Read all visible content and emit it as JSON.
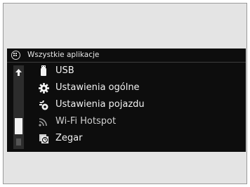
{
  "header": {
    "title": "Wszystkie aplikacje",
    "icon": "apps-grid-icon"
  },
  "scroll": {
    "up_icon": "scroll-up-arrow-icon"
  },
  "items": [
    {
      "label": "USB",
      "icon": "usb-icon"
    },
    {
      "label": "Ustawienia ogólne",
      "icon": "gear-icon"
    },
    {
      "label": "Ustawienia pojazdu",
      "icon": "vehicle-settings-icon"
    },
    {
      "label": "Wi-Fi Hotspot",
      "icon": "wifi-icon"
    },
    {
      "label": "Zegar",
      "icon": "clock-icon"
    }
  ],
  "colors": {
    "screen_bg": "#0d0d0d",
    "text": "#f2f2f2",
    "frame_bg": "#e4e4e4"
  }
}
